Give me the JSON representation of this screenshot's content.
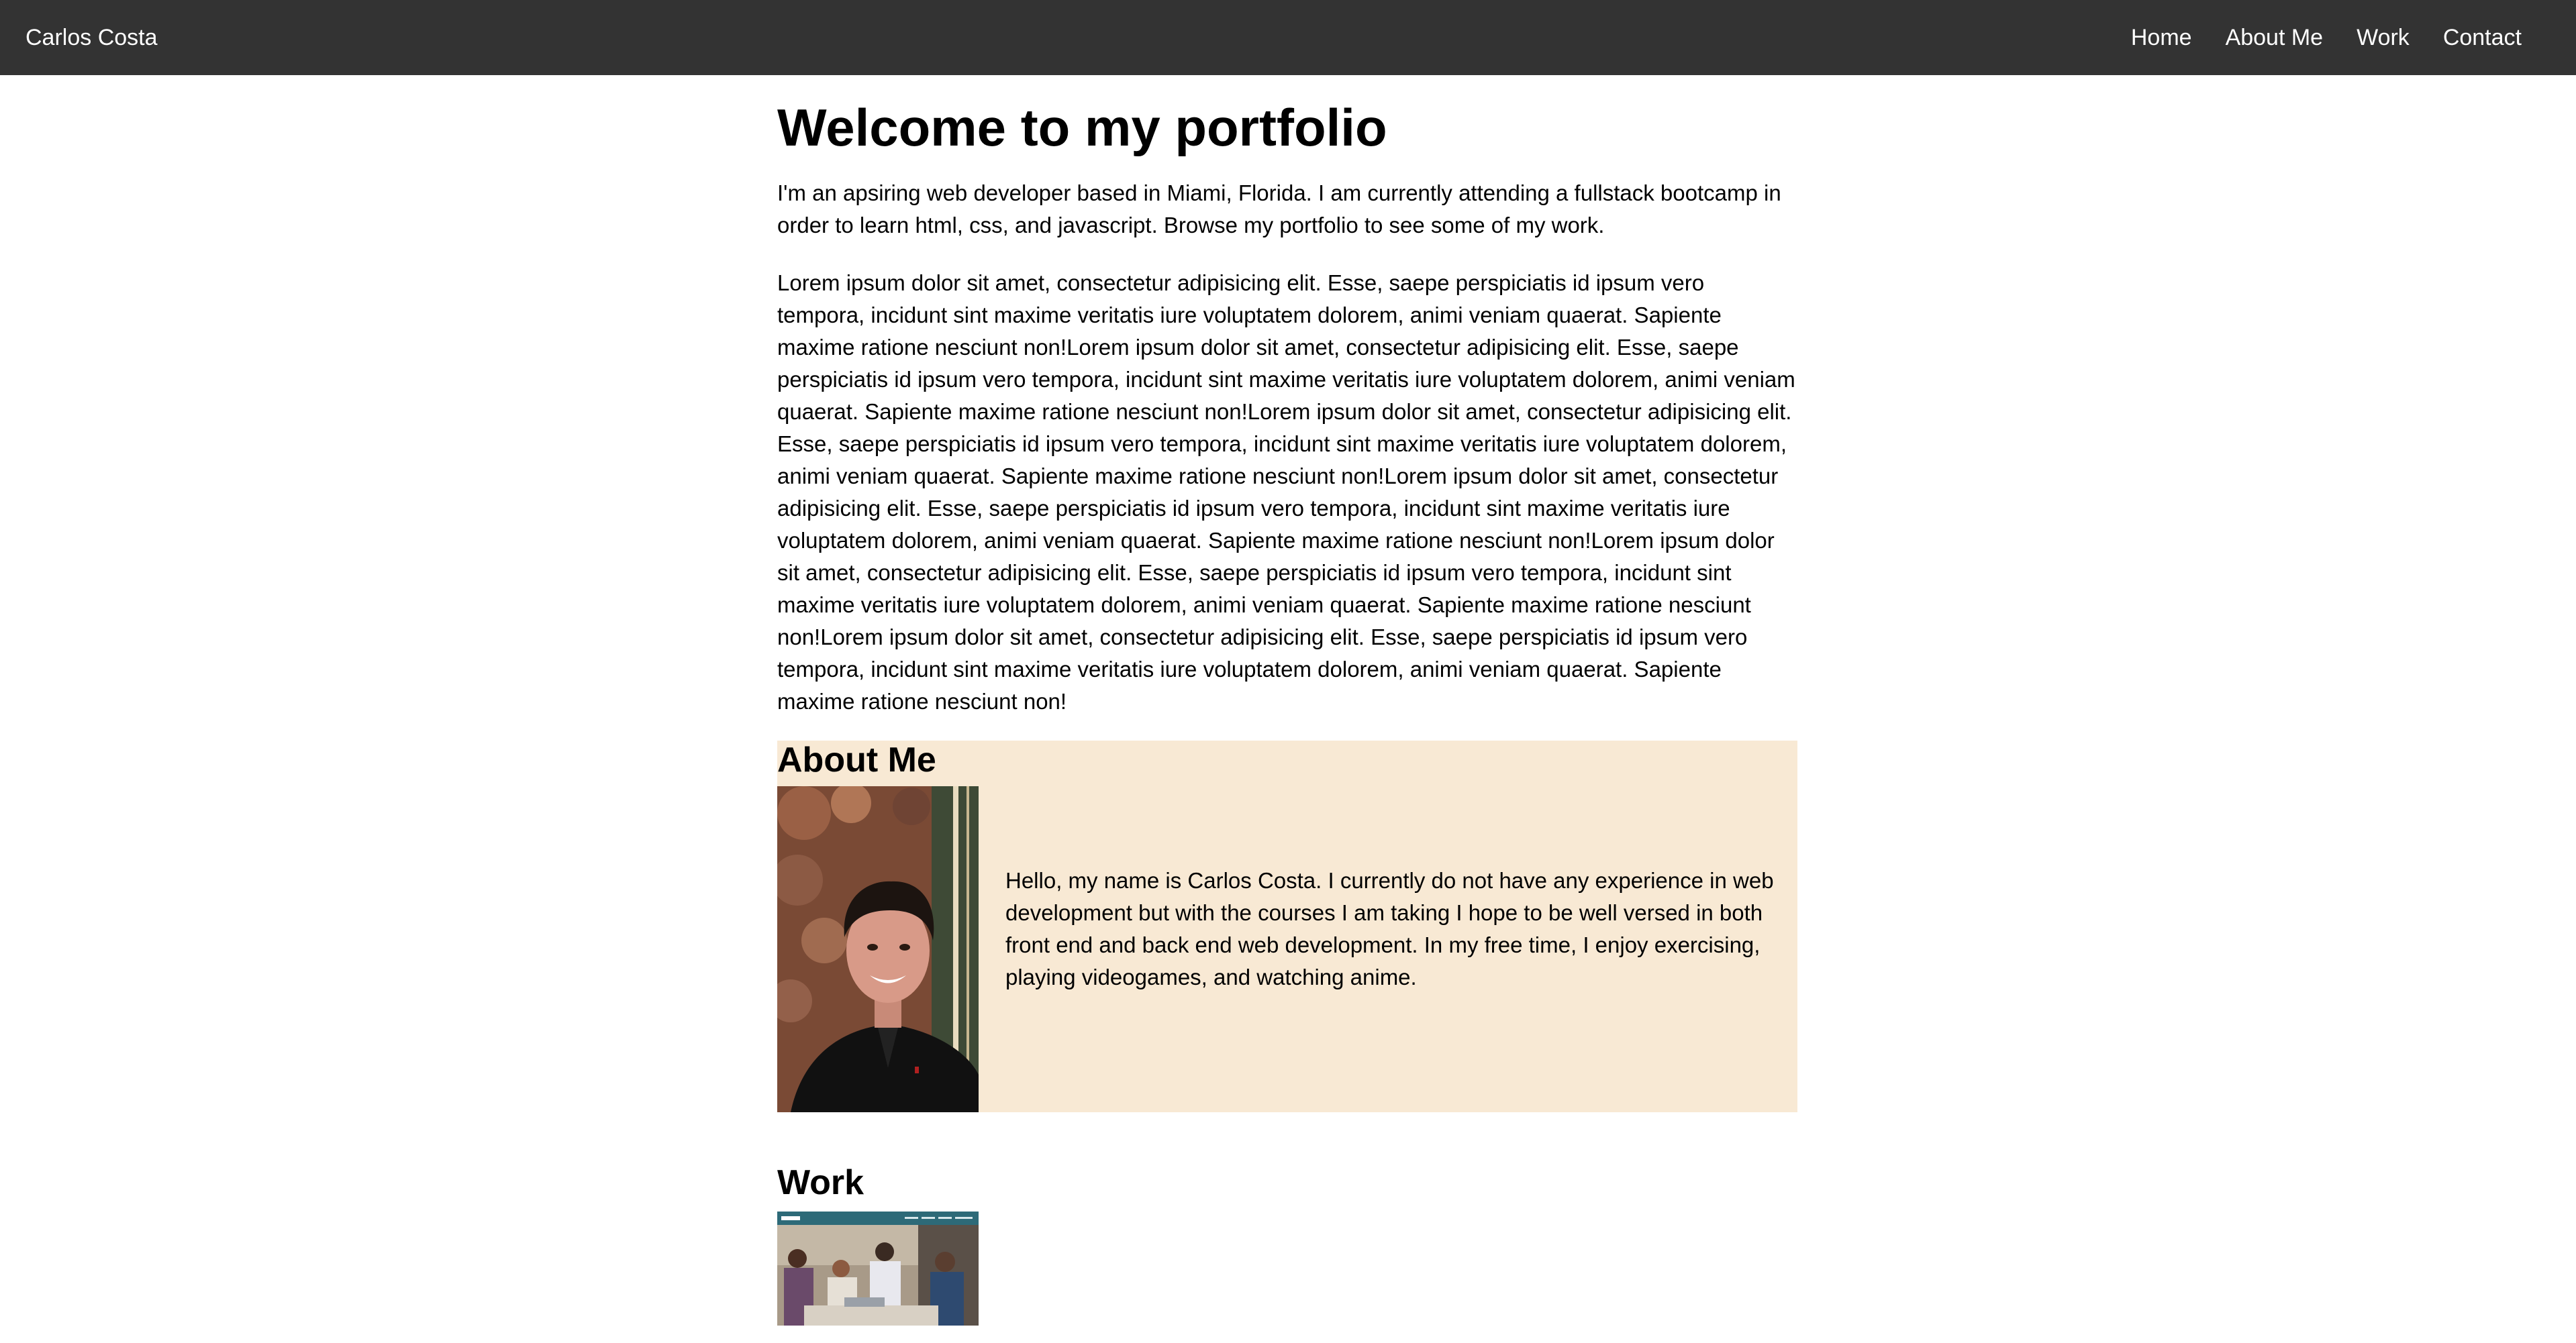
{
  "navbar": {
    "brand": "Carlos Costa",
    "links": [
      "Home",
      "About Me",
      "Work",
      "Contact"
    ],
    "bg_color": "#333333"
  },
  "main": {
    "title": "Welcome to my portfolio",
    "intro": "I'm an apsiring web developer based in Miami, Florida. I am currently attending a fullstack bootcamp in order to learn html, css, and javascript. Browse my portfolio to see some of my work.",
    "lorem": "Lorem ipsum dolor sit amet, consectetur adipisicing elit. Esse, saepe perspiciatis id ipsum vero tempora, incidunt sint maxime veritatis iure voluptatem dolorem, animi veniam quaerat. Sapiente maxime ratione nesciunt non!Lorem ipsum dolor sit amet, consectetur adipisicing elit. Esse, saepe perspiciatis id ipsum vero tempora, incidunt sint maxime veritatis iure voluptatem dolorem, animi veniam quaerat. Sapiente maxime ratione nesciunt non!Lorem ipsum dolor sit amet, consectetur adipisicing elit. Esse, saepe perspiciatis id ipsum vero tempora, incidunt sint maxime veritatis iure voluptatem dolorem, animi veniam quaerat. Sapiente maxime ratione nesciunt non!Lorem ipsum dolor sit amet, consectetur adipisicing elit. Esse, saepe perspiciatis id ipsum vero tempora, incidunt sint maxime veritatis iure voluptatem dolorem, animi veniam quaerat. Sapiente maxime ratione nesciunt non!Lorem ipsum dolor sit amet, consectetur adipisicing elit. Esse, saepe perspiciatis id ipsum vero tempora, incidunt sint maxime veritatis iure voluptatem dolorem, animi veniam quaerat. Sapiente maxime ratione nesciunt non!Lorem ipsum dolor sit amet, consectetur adipisicing elit. Esse, saepe perspiciatis id ipsum vero tempora, incidunt sint maxime veritatis iure voluptatem dolorem, animi veniam quaerat. Sapiente maxime ratione nesciunt non!"
  },
  "about": {
    "heading": "About Me",
    "text": "Hello, my name is Carlos Costa. I currently do not have any experience in web development but with the courses I am taking I hope to be well versed in both front end and back end web development. In my free time, I enjoy exercising, playing videogames, and watching anime.",
    "bg_color": "#f8e9d4"
  },
  "work": {
    "heading": "Work"
  }
}
